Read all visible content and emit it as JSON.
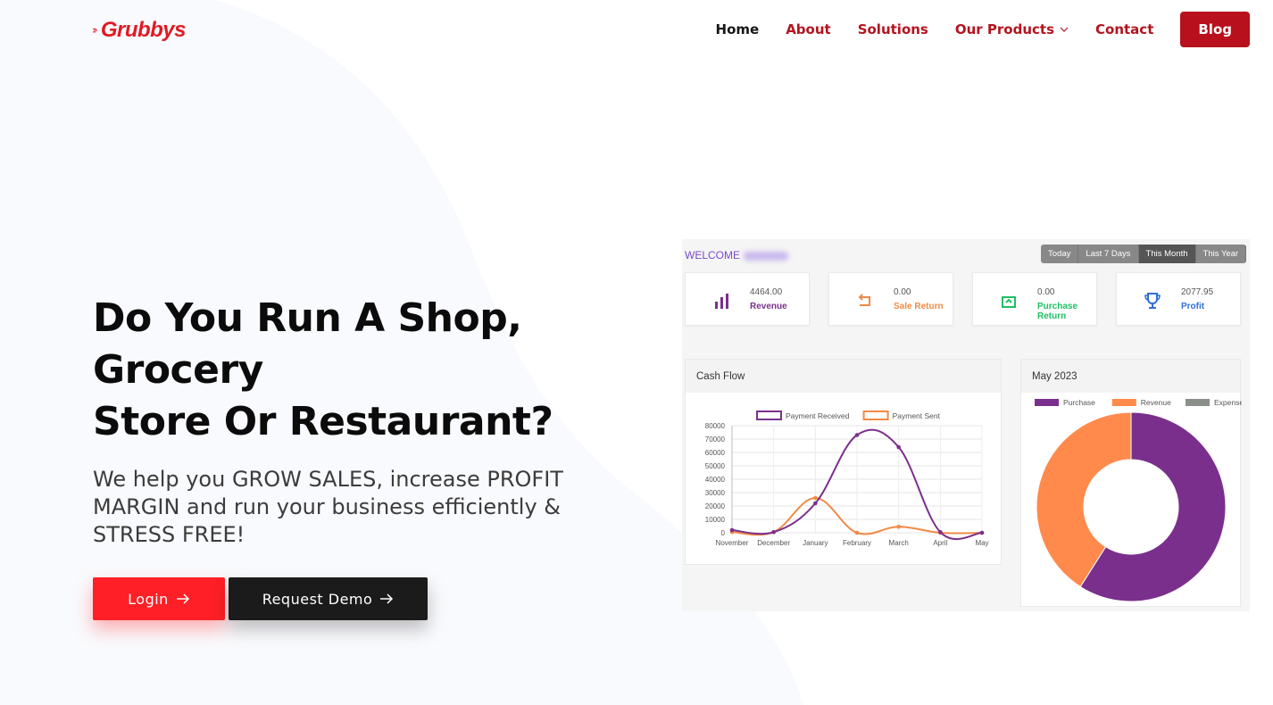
{
  "brand": {
    "name": "Grubbys",
    "color": "#e01b24"
  },
  "nav": {
    "items": [
      {
        "label": "Home",
        "active": true
      },
      {
        "label": "About",
        "active": false
      },
      {
        "label": "Solutions",
        "active": false
      },
      {
        "label": "Our Products",
        "active": false,
        "dropdown": true
      },
      {
        "label": "Contact",
        "active": false
      }
    ],
    "blog_label": "Blog"
  },
  "hero": {
    "title_line1": "Do You Run A Shop, Grocery",
    "title_line2": "Store Or Restaurant?",
    "subtitle": "We help you GROW SALES, increase PROFIT MARGIN and run your business efficiently & STRESS FREE!",
    "login_label": "Login",
    "demo_label": "Request Demo"
  },
  "dashboard": {
    "welcome": "WELCOME",
    "ranges": [
      "Today",
      "Last 7 Days",
      "This Month",
      "This Year"
    ],
    "selected_range": "This Month",
    "stats": [
      {
        "value": "4464.00",
        "label": "Revenue",
        "color": "#7b2f8c",
        "icon": "bar-chart-icon"
      },
      {
        "value": "0.00",
        "label": "Sale Return",
        "color": "#f28a45",
        "icon": "return-icon"
      },
      {
        "value": "0.00",
        "label": "Purchase Return",
        "color": "#1fbf63",
        "icon": "purchase-return-icon"
      },
      {
        "value": "2077.95",
        "label": "Profit",
        "color": "#2f6fd6",
        "icon": "trophy-icon"
      }
    ],
    "cash_flow_title": "Cash Flow",
    "donut_title": "May 2023"
  },
  "chart_data": [
    {
      "type": "line",
      "title": "Cash Flow",
      "categories": [
        "November",
        "December",
        "January",
        "February",
        "March",
        "April",
        "May"
      ],
      "ylim": [
        0,
        80000
      ],
      "yticks": [
        "80000",
        "70000",
        "60000",
        "50000",
        "40000",
        "30000",
        "20000",
        "10000",
        "0"
      ],
      "grid": true,
      "legend": "top",
      "series": [
        {
          "name": "Payment Received",
          "color": "#7b2f8c",
          "values": [
            2000,
            500,
            22000,
            73000,
            64000,
            500,
            0
          ]
        },
        {
          "name": "Payment Sent",
          "color": "#f28a45",
          "values": [
            500,
            500,
            26000,
            0,
            4500,
            0,
            0
          ]
        }
      ]
    },
    {
      "type": "pie",
      "title": "May 2023",
      "legend": "top",
      "series": [
        {
          "name": "Purchase",
          "color": "#7b2f8c",
          "value": 59
        },
        {
          "name": "Revenue",
          "color": "#ff8a4c",
          "value": 41
        },
        {
          "name": "Expense",
          "color": "#8a8f8a",
          "value": 0
        }
      ]
    }
  ]
}
